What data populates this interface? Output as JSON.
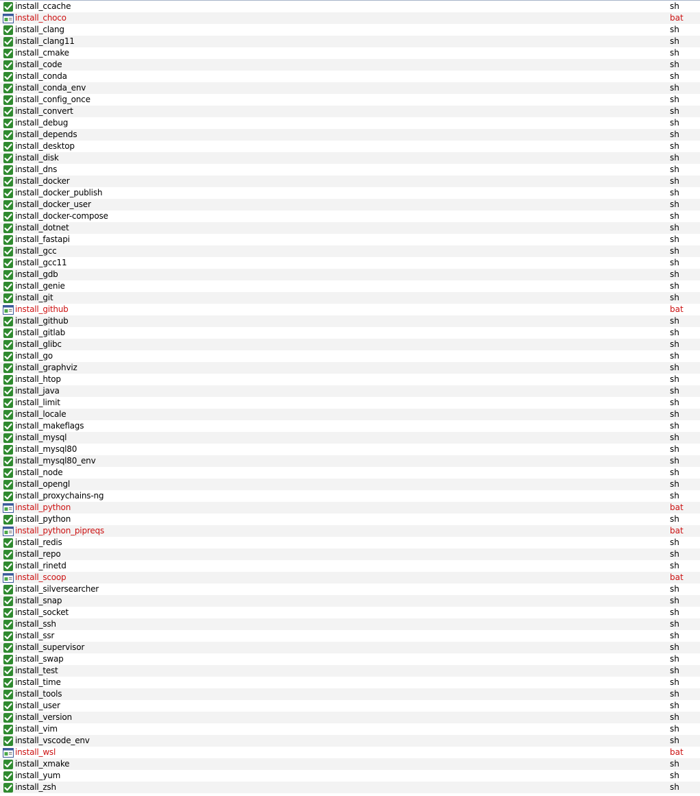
{
  "colors": {
    "sh_text": "#000000",
    "bat_text": "#cc1111",
    "alt_row": "#f3f3f3",
    "sh_icon": "green-check-shield",
    "bat_icon": "batch-file-window"
  },
  "files": [
    {
      "name": "install_ccache",
      "type": "sh",
      "icon": "sh-script-icon"
    },
    {
      "name": "install_choco",
      "type": "bat",
      "icon": "bat-file-icon"
    },
    {
      "name": "install_clang",
      "type": "sh",
      "icon": "sh-script-icon"
    },
    {
      "name": "install_clang11",
      "type": "sh",
      "icon": "sh-script-icon"
    },
    {
      "name": "install_cmake",
      "type": "sh",
      "icon": "sh-script-icon"
    },
    {
      "name": "install_code",
      "type": "sh",
      "icon": "sh-script-icon"
    },
    {
      "name": "install_conda",
      "type": "sh",
      "icon": "sh-script-icon"
    },
    {
      "name": "install_conda_env",
      "type": "sh",
      "icon": "sh-script-icon"
    },
    {
      "name": "install_config_once",
      "type": "sh",
      "icon": "sh-script-icon"
    },
    {
      "name": "install_convert",
      "type": "sh",
      "icon": "sh-script-icon"
    },
    {
      "name": "install_debug",
      "type": "sh",
      "icon": "sh-script-icon"
    },
    {
      "name": "install_depends",
      "type": "sh",
      "icon": "sh-script-icon"
    },
    {
      "name": "install_desktop",
      "type": "sh",
      "icon": "sh-script-icon"
    },
    {
      "name": "install_disk",
      "type": "sh",
      "icon": "sh-script-icon"
    },
    {
      "name": "install_dns",
      "type": "sh",
      "icon": "sh-script-icon"
    },
    {
      "name": "install_docker",
      "type": "sh",
      "icon": "sh-script-icon"
    },
    {
      "name": "install_docker_publish",
      "type": "sh",
      "icon": "sh-script-icon"
    },
    {
      "name": "install_docker_user",
      "type": "sh",
      "icon": "sh-script-icon"
    },
    {
      "name": "install_docker-compose",
      "type": "sh",
      "icon": "sh-script-icon"
    },
    {
      "name": "install_dotnet",
      "type": "sh",
      "icon": "sh-script-icon"
    },
    {
      "name": "install_fastapi",
      "type": "sh",
      "icon": "sh-script-icon"
    },
    {
      "name": "install_gcc",
      "type": "sh",
      "icon": "sh-script-icon"
    },
    {
      "name": "install_gcc11",
      "type": "sh",
      "icon": "sh-script-icon"
    },
    {
      "name": "install_gdb",
      "type": "sh",
      "icon": "sh-script-icon"
    },
    {
      "name": "install_genie",
      "type": "sh",
      "icon": "sh-script-icon"
    },
    {
      "name": "install_git",
      "type": "sh",
      "icon": "sh-script-icon"
    },
    {
      "name": "install_github",
      "type": "bat",
      "icon": "bat-file-icon"
    },
    {
      "name": "install_github",
      "type": "sh",
      "icon": "sh-script-icon"
    },
    {
      "name": "install_gitlab",
      "type": "sh",
      "icon": "sh-script-icon"
    },
    {
      "name": "install_glibc",
      "type": "sh",
      "icon": "sh-script-icon"
    },
    {
      "name": "install_go",
      "type": "sh",
      "icon": "sh-script-icon"
    },
    {
      "name": "install_graphviz",
      "type": "sh",
      "icon": "sh-script-icon"
    },
    {
      "name": "install_htop",
      "type": "sh",
      "icon": "sh-script-icon"
    },
    {
      "name": "install_java",
      "type": "sh",
      "icon": "sh-script-icon"
    },
    {
      "name": "install_limit",
      "type": "sh",
      "icon": "sh-script-icon"
    },
    {
      "name": "install_locale",
      "type": "sh",
      "icon": "sh-script-icon"
    },
    {
      "name": "install_makeflags",
      "type": "sh",
      "icon": "sh-script-icon"
    },
    {
      "name": "install_mysql",
      "type": "sh",
      "icon": "sh-script-icon"
    },
    {
      "name": "install_mysql80",
      "type": "sh",
      "icon": "sh-script-icon"
    },
    {
      "name": "install_mysql80_env",
      "type": "sh",
      "icon": "sh-script-icon"
    },
    {
      "name": "install_node",
      "type": "sh",
      "icon": "sh-script-icon"
    },
    {
      "name": "install_opengl",
      "type": "sh",
      "icon": "sh-script-icon"
    },
    {
      "name": "install_proxychains-ng",
      "type": "sh",
      "icon": "sh-script-icon"
    },
    {
      "name": "install_python",
      "type": "bat",
      "icon": "bat-file-icon"
    },
    {
      "name": "install_python",
      "type": "sh",
      "icon": "sh-script-icon"
    },
    {
      "name": "install_python_pipreqs",
      "type": "bat",
      "icon": "bat-file-icon"
    },
    {
      "name": "install_redis",
      "type": "sh",
      "icon": "sh-script-icon"
    },
    {
      "name": "install_repo",
      "type": "sh",
      "icon": "sh-script-icon"
    },
    {
      "name": "install_rinetd",
      "type": "sh",
      "icon": "sh-script-icon"
    },
    {
      "name": "install_scoop",
      "type": "bat",
      "icon": "bat-file-icon"
    },
    {
      "name": "install_silversearcher",
      "type": "sh",
      "icon": "sh-script-icon"
    },
    {
      "name": "install_snap",
      "type": "sh",
      "icon": "sh-script-icon"
    },
    {
      "name": "install_socket",
      "type": "sh",
      "icon": "sh-script-icon"
    },
    {
      "name": "install_ssh",
      "type": "sh",
      "icon": "sh-script-icon"
    },
    {
      "name": "install_ssr",
      "type": "sh",
      "icon": "sh-script-icon"
    },
    {
      "name": "install_supervisor",
      "type": "sh",
      "icon": "sh-script-icon"
    },
    {
      "name": "install_swap",
      "type": "sh",
      "icon": "sh-script-icon"
    },
    {
      "name": "install_test",
      "type": "sh",
      "icon": "sh-script-icon"
    },
    {
      "name": "install_time",
      "type": "sh",
      "icon": "sh-script-icon"
    },
    {
      "name": "install_tools",
      "type": "sh",
      "icon": "sh-script-icon"
    },
    {
      "name": "install_user",
      "type": "sh",
      "icon": "sh-script-icon"
    },
    {
      "name": "install_version",
      "type": "sh",
      "icon": "sh-script-icon"
    },
    {
      "name": "install_vim",
      "type": "sh",
      "icon": "sh-script-icon"
    },
    {
      "name": "install_vscode_env",
      "type": "sh",
      "icon": "sh-script-icon"
    },
    {
      "name": "install_wsl",
      "type": "bat",
      "icon": "bat-file-icon"
    },
    {
      "name": "install_xmake",
      "type": "sh",
      "icon": "sh-script-icon"
    },
    {
      "name": "install_yum",
      "type": "sh",
      "icon": "sh-script-icon"
    },
    {
      "name": "install_zsh",
      "type": "sh",
      "icon": "sh-script-icon"
    }
  ]
}
